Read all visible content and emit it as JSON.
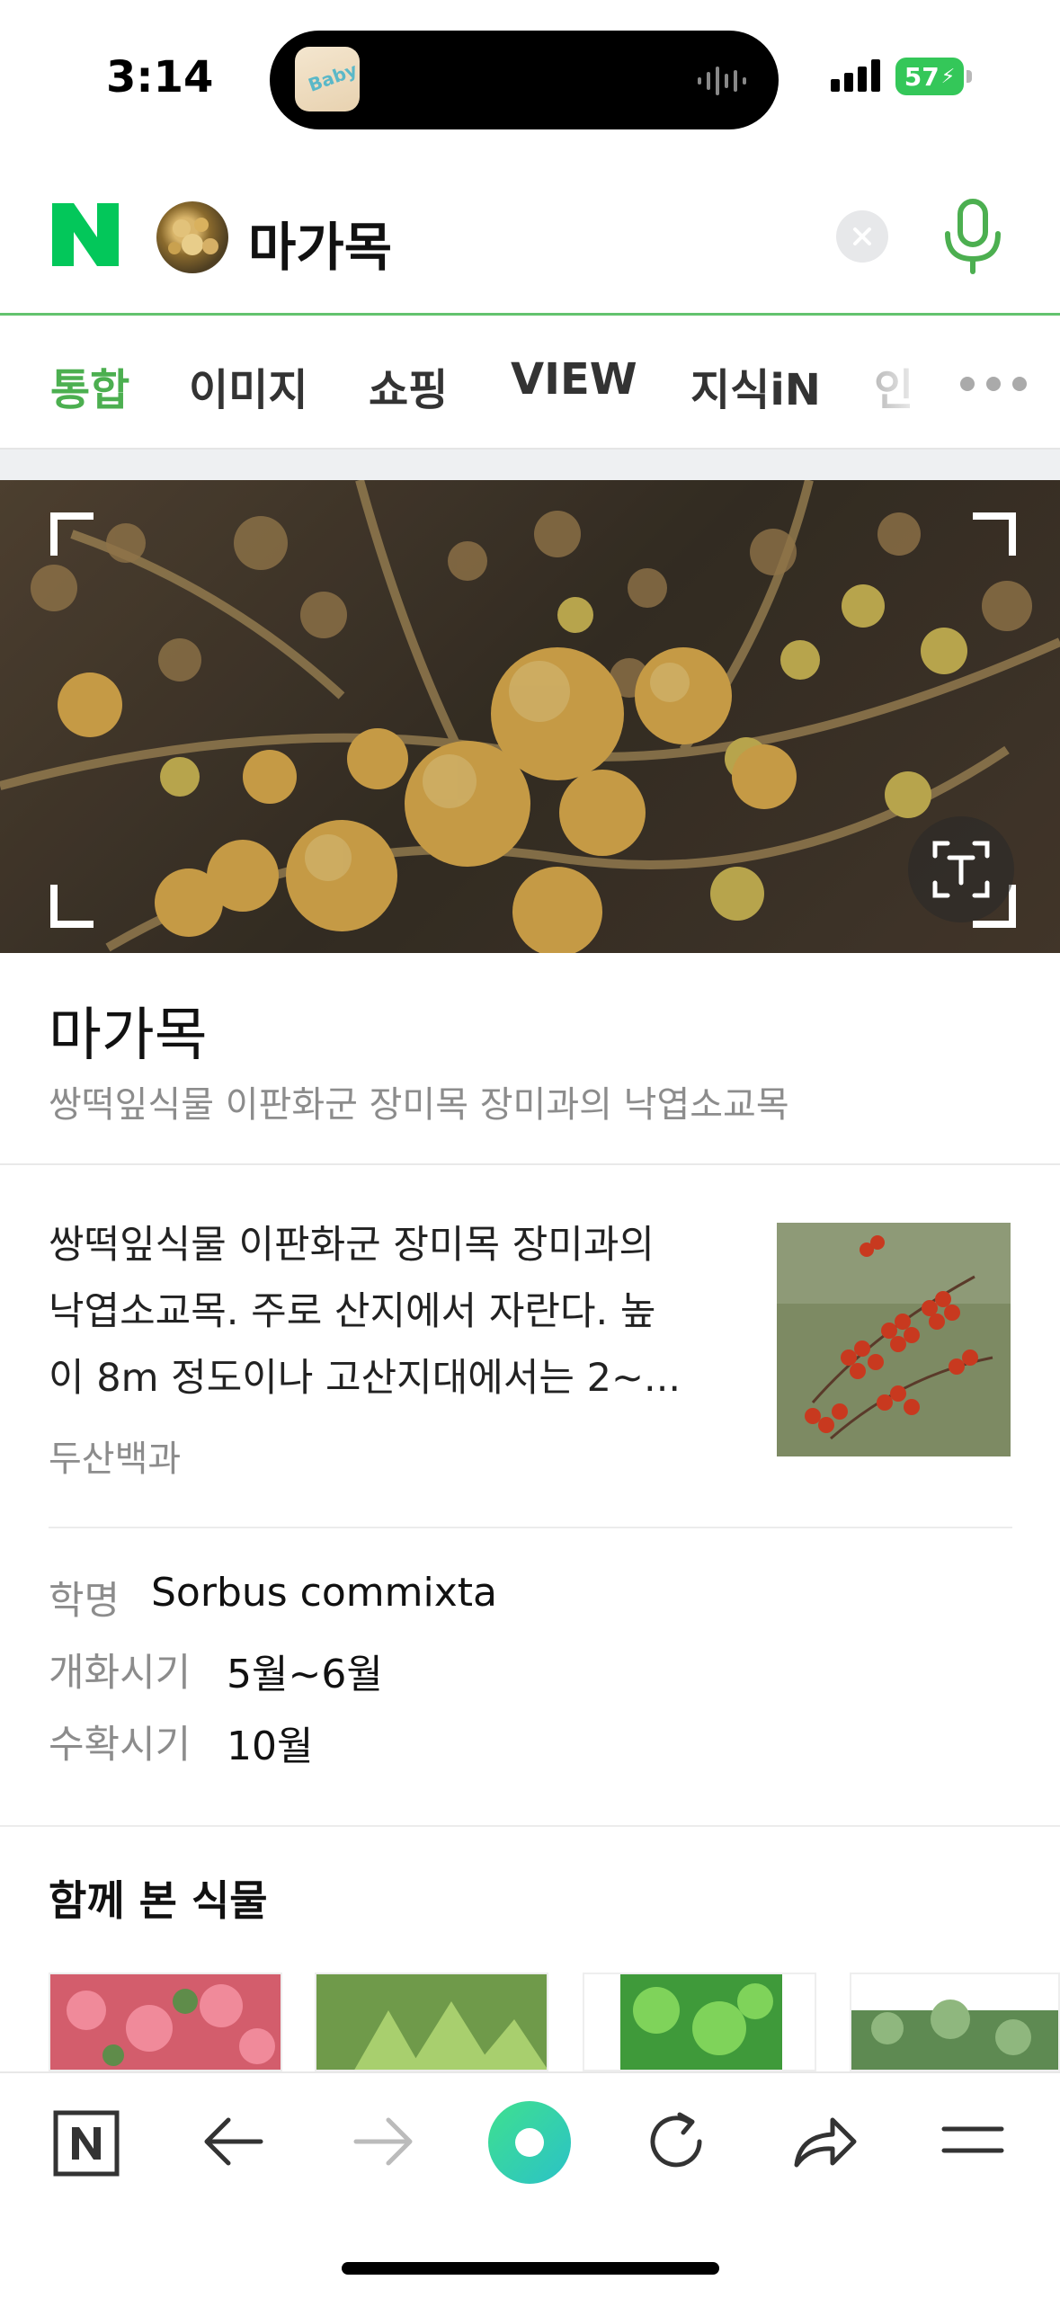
{
  "status_bar": {
    "time": "3:14",
    "battery": "57",
    "app_icon_text": "Baby"
  },
  "search": {
    "query": "마가목"
  },
  "tabs": [
    {
      "label": "통합",
      "active": true
    },
    {
      "label": "이미지"
    },
    {
      "label": "쇼핑"
    },
    {
      "label": "VIEW"
    },
    {
      "label": "지식iN"
    },
    {
      "label": "인"
    }
  ],
  "result": {
    "title": "마가목",
    "subtitle": "쌍떡잎식물 이판화군 장미목 장미과의 낙엽소교목",
    "description": {
      "line1": "쌍떡잎식물 이판화군 장미목 장미과의",
      "line2": "낙엽소교목. 주로 산지에서 자란다. 높",
      "line3": "이 8m 정도이나 고산지대에서는 2~...",
      "source": "두산백과"
    },
    "info": [
      {
        "label": "학명",
        "value": "Sorbus commixta"
      },
      {
        "label": "개화시기",
        "value": "5월~6월"
      },
      {
        "label": "수확시기",
        "value": "10월"
      }
    ]
  },
  "related": {
    "heading": "함께 본 식물"
  },
  "colors": {
    "brand_green": "#03c75a",
    "accent_green": "#4caf50",
    "divider": "#e9e9e9"
  },
  "icons": {
    "bottom_nav": [
      "naver-home-icon",
      "back-arrow-icon",
      "forward-arrow-icon",
      "green-dot-icon",
      "refresh-icon",
      "share-icon",
      "menu-icon"
    ]
  }
}
